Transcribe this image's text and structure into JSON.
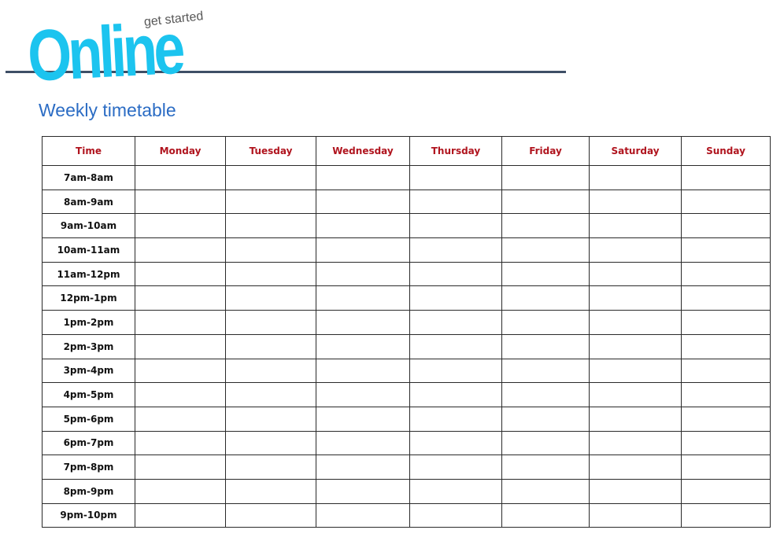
{
  "logo": {
    "tagline": "get started",
    "word": "Online"
  },
  "title": "Weekly timetable",
  "colors": {
    "logo": "#1cc4ef",
    "title": "#2b6cc4",
    "header_text": "#b0141e",
    "rule": "#3e4f66"
  },
  "table": {
    "headers": [
      "Time",
      "Monday",
      "Tuesday",
      "Wednesday",
      "Thursday",
      "Friday",
      "Saturday",
      "Sunday"
    ],
    "rows": [
      {
        "time": "7am-8am"
      },
      {
        "time": "8am-9am"
      },
      {
        "time": "9am-10am"
      },
      {
        "time": "10am-11am"
      },
      {
        "time": "11am-12pm"
      },
      {
        "time": "12pm-1pm"
      },
      {
        "time": "1pm-2pm"
      },
      {
        "time": "2pm-3pm"
      },
      {
        "time": "3pm-4pm"
      },
      {
        "time": "4pm-5pm"
      },
      {
        "time": "5pm-6pm"
      },
      {
        "time": "6pm-7pm"
      },
      {
        "time": "7pm-8pm"
      },
      {
        "time": "8pm-9pm"
      },
      {
        "time": "9pm-10pm"
      }
    ]
  }
}
